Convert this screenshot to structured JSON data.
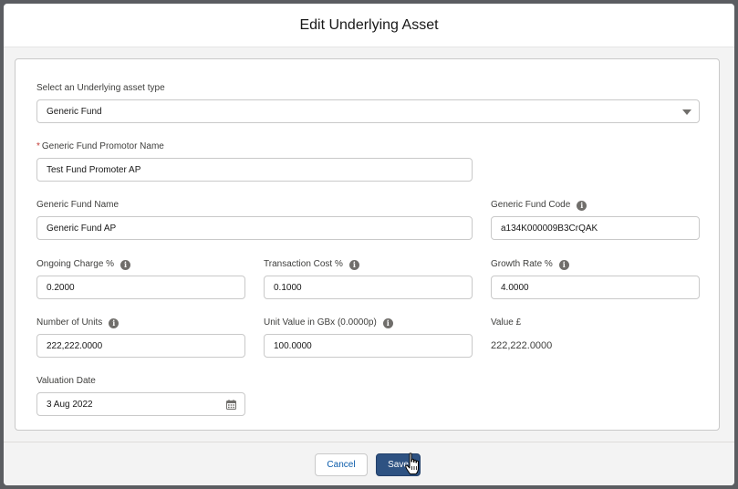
{
  "modal": {
    "title": "Edit Underlying Asset"
  },
  "fields": {
    "asset_type": {
      "label": "Select an Underlying asset type",
      "value": "Generic Fund"
    },
    "promotor_name": {
      "required_marker": "*",
      "label": "Generic Fund Promotor Name",
      "value": "Test Fund Promoter AP"
    },
    "fund_name": {
      "label": "Generic Fund Name",
      "value": "Generic Fund AP"
    },
    "fund_code": {
      "label": "Generic Fund Code",
      "value": "a134K000009B3CrQAK"
    },
    "ongoing_charge": {
      "label": "Ongoing Charge %",
      "value": "0.2000"
    },
    "transaction_cost": {
      "label": "Transaction Cost %",
      "value": "0.1000"
    },
    "growth_rate": {
      "label": "Growth Rate %",
      "value": "4.0000"
    },
    "number_of_units": {
      "label": "Number of Units",
      "value": "222,222.0000"
    },
    "unit_value": {
      "label": "Unit Value in GBx (0.0000p)",
      "value": "100.0000"
    },
    "value_gbp": {
      "label": "Value £",
      "value": "222,222.0000"
    },
    "valuation_date": {
      "label": "Valuation Date",
      "value": "3 Aug 2022"
    }
  },
  "info_icon_glyph": "i",
  "footer": {
    "cancel_label": "Cancel",
    "save_label": "Save"
  },
  "colors": {
    "brand_button": "#2e5282",
    "link": "#0b5cab",
    "required": "#c23934"
  }
}
